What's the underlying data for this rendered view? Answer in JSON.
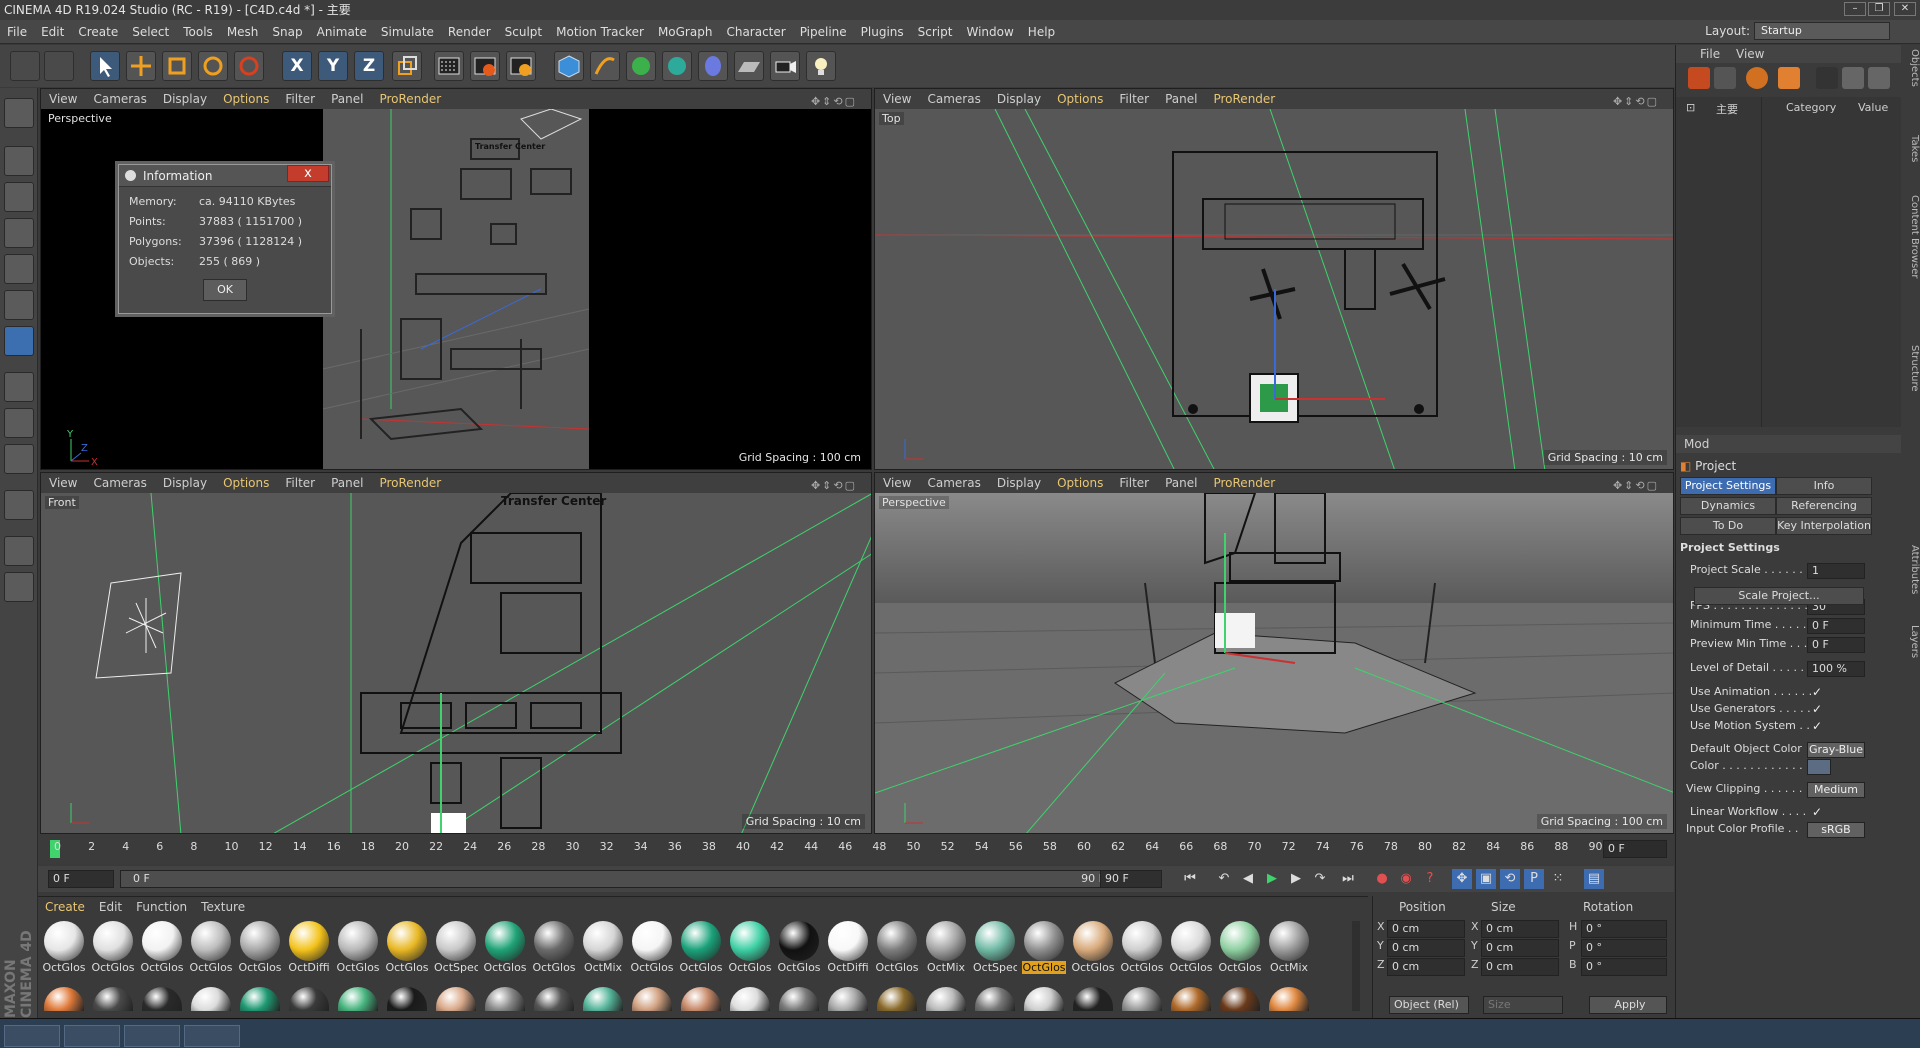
{
  "window": {
    "title": "CINEMA 4D R19.024 Studio (RC - R19) - [C4D.c4d *] - 主要",
    "layout_label": "Layout:",
    "layout_value": "Startup"
  },
  "menu": [
    "File",
    "Edit",
    "Create",
    "Select",
    "Tools",
    "Mesh",
    "Snap",
    "Animate",
    "Simulate",
    "Render",
    "Sculpt",
    "Motion Tracker",
    "MoGraph",
    "Character",
    "Pipeline",
    "Plugins",
    "Script",
    "Window",
    "Help"
  ],
  "toolbar": {
    "axis_x": "X",
    "axis_y": "Y",
    "axis_z": "Z"
  },
  "viewport_menu": [
    "View",
    "Cameras",
    "Display",
    "Options",
    "Filter",
    "Panel",
    "ProRender"
  ],
  "viewports": [
    {
      "label": "Perspective",
      "grid": "Grid Spacing : 100 cm"
    },
    {
      "label": "Top",
      "grid": "Grid Spacing : 10 cm"
    },
    {
      "label": "Front",
      "grid": "Grid Spacing : 10 cm"
    },
    {
      "label": "Perspective",
      "grid": "Grid Spacing : 100 cm"
    }
  ],
  "viewport_scene_text": {
    "transfer_center": "Transfer Center"
  },
  "axis_labels": {
    "x": "X",
    "y": "Y",
    "z": "Z"
  },
  "info_dialog": {
    "title": "Information",
    "close": "x",
    "memory_label": "Memory:",
    "memory_value": "ca. 94110 KBytes",
    "points_label": "Points:",
    "points_value": "37883 ( 1151700 )",
    "polygons_label": "Polygons:",
    "polygons_value": "37396 ( 1128124 )",
    "objects_label": "Objects:",
    "objects_value": "255 ( 869 )",
    "ok": "OK"
  },
  "timeline": {
    "ticks": [
      "0",
      "2",
      "4",
      "6",
      "8",
      "10",
      "12",
      "14",
      "16",
      "18",
      "20",
      "22",
      "24",
      "26",
      "28",
      "30",
      "32",
      "34",
      "36",
      "38",
      "40",
      "42",
      "44",
      "46",
      "48",
      "50",
      "52",
      "54",
      "56",
      "58",
      "60",
      "62",
      "64",
      "66",
      "68",
      "70",
      "72",
      "74",
      "76",
      "78",
      "80",
      "82",
      "84",
      "86",
      "88",
      "90"
    ],
    "current_frame": "0 F"
  },
  "transport": {
    "start": "0 F",
    "range_start": "0 F",
    "range_end": "90 F",
    "end": "90 F"
  },
  "material_manager": {
    "menu": [
      "Create",
      "Edit",
      "Function",
      "Texture"
    ],
    "materials": [
      {
        "name": "OctGlos",
        "color": "#e6e6e6"
      },
      {
        "name": "OctGlos",
        "color": "#e0e0e0"
      },
      {
        "name": "OctGlos",
        "color": "#f2f2f2"
      },
      {
        "name": "OctGlos",
        "color": "#bdbdbd"
      },
      {
        "name": "OctGlos",
        "color": "#a8a8a8"
      },
      {
        "name": "OctDiffi",
        "color": "#f3c21a"
      },
      {
        "name": "OctGlos",
        "color": "#b8b8b8"
      },
      {
        "name": "OctGlos",
        "color": "#e8b723"
      },
      {
        "name": "OctSpec",
        "color": "#c8c8c8"
      },
      {
        "name": "OctGlos",
        "color": "#1fa377"
      },
      {
        "name": "OctGlos",
        "color": "#6a6a6a"
      },
      {
        "name": "OctMix",
        "color": "#d5d5d5"
      },
      {
        "name": "OctGlos",
        "color": "#f5f5f5"
      },
      {
        "name": "OctGlos",
        "color": "#1aa27a"
      },
      {
        "name": "OctGlos",
        "color": "#3ccfa3"
      },
      {
        "name": "OctGlos",
        "color": "#111111"
      },
      {
        "name": "OctDiffi",
        "color": "#f8f8f8"
      },
      {
        "name": "OctGlos",
        "color": "#7d7d7d"
      },
      {
        "name": "OctMix",
        "color": "#a3a3a3"
      },
      {
        "name": "OctSpec",
        "color": "#6fb9a4"
      },
      {
        "name": "OctGlos",
        "color": "#8f8f8f"
      },
      {
        "name": "OctGlos",
        "color": "#d8a97a"
      },
      {
        "name": "OctGlos",
        "color": "#cfcfcf"
      },
      {
        "name": "OctGlos",
        "color": "#dadada"
      },
      {
        "name": "OctGlos",
        "color": "#8dcfa0"
      },
      {
        "name": "OctMix",
        "color": "#9c9c9c"
      }
    ],
    "row2_colors": [
      "#e07a3a",
      "#4a4a4a",
      "#2a2a2a",
      "#dcdcdc",
      "#1e9a72",
      "#3a3a3a",
      "#47b57f",
      "#1a1a1a",
      "#d9a98a",
      "#888",
      "#555",
      "#55b59a",
      "#d0a080",
      "#c88a6a",
      "#ddd",
      "#7a7a7a",
      "#aaa",
      "#8a6a2a",
      "#bbb",
      "#777",
      "#cfcfcf",
      "#222",
      "#999",
      "#b06a2a",
      "#6a3a1a",
      "#e08840"
    ],
    "selected_index": 20
  },
  "coordinates": {
    "position_header": "Position",
    "size_header": "Size",
    "rotation_header": "Rotation",
    "rows": [
      {
        "axis": "X",
        "pos": "0 cm",
        "size_axis": "X",
        "size": "0 cm",
        "rot_axis": "H",
        "rot": "0 °"
      },
      {
        "axis": "Y",
        "pos": "0 cm",
        "size_axis": "Y",
        "size": "0 cm",
        "rot_axis": "P",
        "rot": "0 °"
      },
      {
        "axis": "Z",
        "pos": "0 cm",
        "size_axis": "Z",
        "size": "0 cm",
        "rot_axis": "B",
        "rot": "0 °"
      }
    ],
    "mode": "Object (Rel)",
    "size_mode": "Size",
    "apply": "Apply"
  },
  "object_manager": {
    "menu": [
      "File",
      "View"
    ],
    "root_item": "主要",
    "col_category": "Category",
    "col_value": "Value"
  },
  "attributes": {
    "mode": "Mod",
    "title": "Project",
    "tabs": [
      "Project Settings",
      "Info",
      "Dynamics",
      "Referencing",
      "To Do",
      "Key Interpolation"
    ],
    "section": "Project Settings",
    "fields": [
      {
        "label": "Project Scale . . . . . . .",
        "value": "1",
        "type": "val"
      },
      {
        "label": "FPS . . . . . . . . . . . . . . .",
        "value": "30",
        "type": "val"
      },
      {
        "label": "Minimum Time . . . . . .",
        "value": "0 F",
        "type": "val"
      },
      {
        "label": "Preview Min Time . . . .",
        "value": "0 F",
        "type": "val"
      },
      {
        "label": "Level of Detail . . . . . .",
        "value": "100 %",
        "type": "val"
      },
      {
        "label": "Use Animation . . . . . .",
        "value": "✓",
        "type": "check"
      },
      {
        "label": "Use Generators . . . . .",
        "value": "✓",
        "type": "check"
      },
      {
        "label": "Use Motion System . .",
        "value": "✓",
        "type": "check"
      },
      {
        "label": "Default Object Color",
        "value": "Gray-Blue",
        "type": "drop"
      },
      {
        "label": "Color . . . . . . . . . . . . . .",
        "value": "",
        "type": "swatch"
      },
      {
        "label": "View Clipping . . . . . .",
        "value": "Medium",
        "type": "drop"
      },
      {
        "label": "Linear Workflow . . . .",
        "value": "✓",
        "type": "check"
      },
      {
        "label": "Input Color Profile . .",
        "value": "sRGB",
        "type": "drop"
      }
    ],
    "scale_button": "Scale Project..."
  },
  "side_tabs": [
    "Objects",
    "Takes",
    "Content Browser",
    "Structure",
    "Attributes",
    "Layers"
  ],
  "brand": "MAXON CINEMA 4D"
}
